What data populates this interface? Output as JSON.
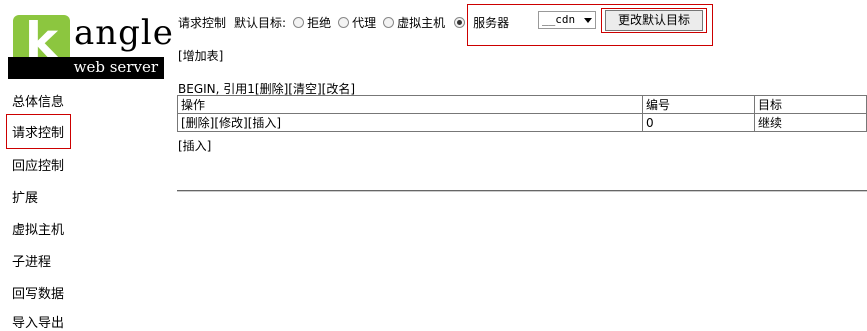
{
  "logo": {
    "letter": "k",
    "word": "angle",
    "subtitle": "web server"
  },
  "sidebar": {
    "items": [
      {
        "label": "总体信息"
      },
      {
        "label": "请求控制"
      },
      {
        "label": "回应控制"
      },
      {
        "label": "扩展"
      },
      {
        "label": "虚拟主机"
      },
      {
        "label": "子进程"
      },
      {
        "label": "回写数据"
      },
      {
        "label": "导入导出"
      }
    ]
  },
  "topbar": {
    "title": "请求控制",
    "default_target_label": "默认目标:",
    "options": [
      {
        "label": "拒绝",
        "checked": false
      },
      {
        "label": "代理",
        "checked": false
      },
      {
        "label": "虚拟主机",
        "checked": false
      },
      {
        "label": "服务器",
        "checked": true
      }
    ],
    "server_select": "__cdn",
    "change_button": "更改默认目标"
  },
  "add_table": "[增加表]",
  "table_header_line": {
    "name": "BEGIN, 引用1",
    "actions": [
      "[删除]",
      "[清空]",
      "[改名]"
    ]
  },
  "rules_table": {
    "columns": [
      "操作",
      "编号",
      "目标"
    ],
    "rows": [
      {
        "actions": [
          "[删除]",
          "[修改]",
          "[插入]"
        ],
        "id": "0",
        "target": "继续"
      }
    ]
  },
  "insert_bottom": "[插入]"
}
